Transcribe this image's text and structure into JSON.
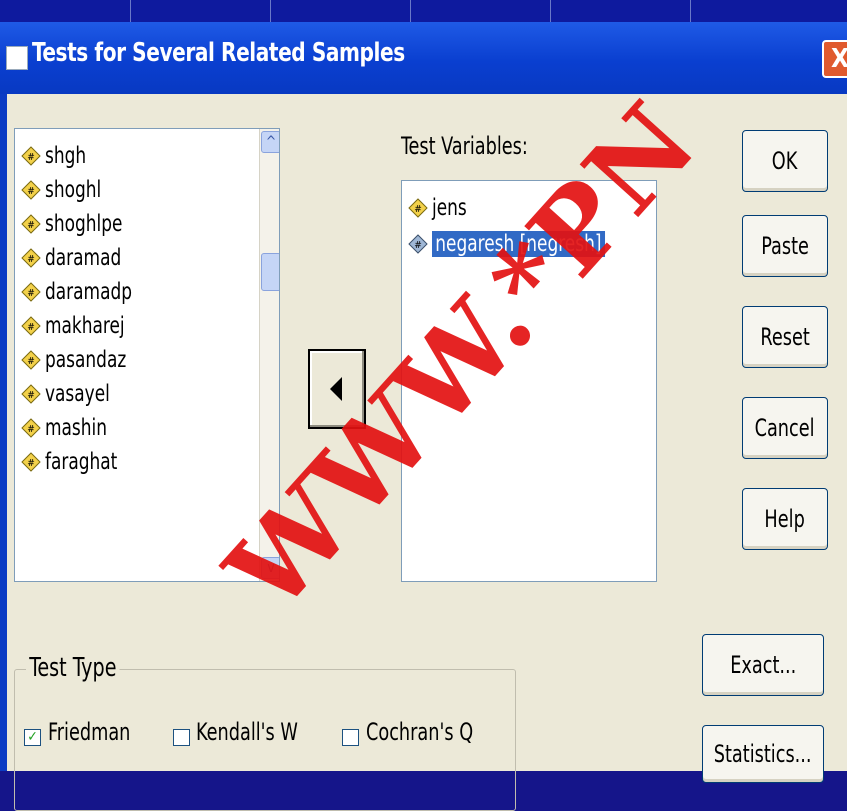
{
  "window": {
    "title": "Tests for Several Related Samples",
    "close_label": "X"
  },
  "source_list": {
    "items": [
      {
        "label": "shgh"
      },
      {
        "label": "shoghl"
      },
      {
        "label": "shoghlpe"
      },
      {
        "label": "daramad"
      },
      {
        "label": "daramadp"
      },
      {
        "label": "makharej"
      },
      {
        "label": "pasandaz"
      },
      {
        "label": "vasayel"
      },
      {
        "label": "mashin"
      },
      {
        "label": "faraghat"
      }
    ],
    "scroll_up": "^",
    "scroll_down": "v"
  },
  "test_variables": {
    "label": "Test Variables:",
    "items": [
      {
        "label": "jens"
      },
      {
        "label": "negaresh [negresh]",
        "selected": true
      }
    ]
  },
  "buttons": {
    "ok": "OK",
    "paste": "Paste",
    "reset": "Reset",
    "cancel": "Cancel",
    "help": "Help",
    "exact": "Exact...",
    "statistics": "Statistics..."
  },
  "test_type": {
    "title": "Test Type",
    "options": [
      {
        "label": "Friedman",
        "checked": true
      },
      {
        "label": "Kendall's W",
        "checked": false
      },
      {
        "label": "Cochran's Q",
        "checked": false
      }
    ],
    "check_mark": "✓"
  },
  "watermark": "WWW.*PN",
  "colors": {
    "selection": "#316ac5",
    "dialog_bg": "#ece9d8",
    "titlebar": "#0a3fd0",
    "watermark": "#e31212"
  }
}
